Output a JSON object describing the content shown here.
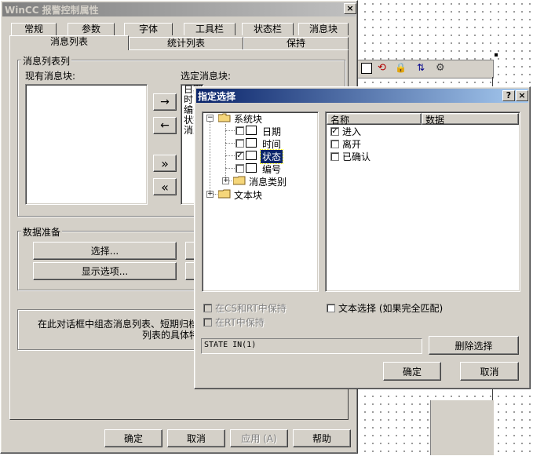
{
  "main_dialog": {
    "title": "WinCC 报警控制属性",
    "tabs_row1": [
      "常规",
      "参数",
      "字体",
      "工具栏",
      "状态栏",
      "消息块"
    ],
    "tabs_row2": [
      "消息列表",
      "统计列表",
      "保持"
    ],
    "active_tab": "消息列表",
    "group_message_list": "消息列表列",
    "existing_blocks_label": "现有消息块:",
    "selected_blocks_label": "选定消息块:",
    "selected_blocks_items": [
      "日期",
      "时间",
      "编号",
      "状态",
      "消息"
    ],
    "arrow_right": "→",
    "arrow_left": "←",
    "all_right": "»",
    "all_left": "«",
    "group_data_prep": "数据准备",
    "select_btn": "选择...",
    "display_options_btn": "显示选项...",
    "info_text_line1": "在此对话框中组态消息列表、短期归档",
    "info_text_line2": "列表的具体特",
    "ok": "确定",
    "cancel": "取消",
    "apply": "应用 (A)",
    "help": "帮助"
  },
  "sub_dialog": {
    "title": "指定选择",
    "help_btn": "?",
    "close_btn": "×",
    "tree": {
      "root": "系统块",
      "children": [
        {
          "label": "日期",
          "checked": false
        },
        {
          "label": "时间",
          "checked": false
        },
        {
          "label": "状态",
          "checked": true
        },
        {
          "label": "编号",
          "checked": false
        }
      ],
      "subgroup": "消息类别",
      "text_block": "文本块"
    },
    "list_headers": [
      "名称",
      "数据"
    ],
    "list_items": [
      {
        "label": "进入",
        "checked": true
      },
      {
        "label": "离开",
        "checked": false
      },
      {
        "label": "已确认",
        "checked": false
      }
    ],
    "keep_in_cs_rt": "在CS和RT中保持",
    "keep_in_rt": "在RT中保持",
    "text_select": "文本选择 (如果完全匹配)",
    "expression": "STATE IN(1)",
    "delete_select": "删除选择",
    "ok": "确定",
    "cancel": "取消"
  },
  "colors": {
    "dialog_face": "#d4d0c8",
    "active_title_start": "#0a246a",
    "active_title_end": "#a6caf0",
    "inactive_title_start": "#808080",
    "inactive_title_end": "#c0c0c0"
  }
}
